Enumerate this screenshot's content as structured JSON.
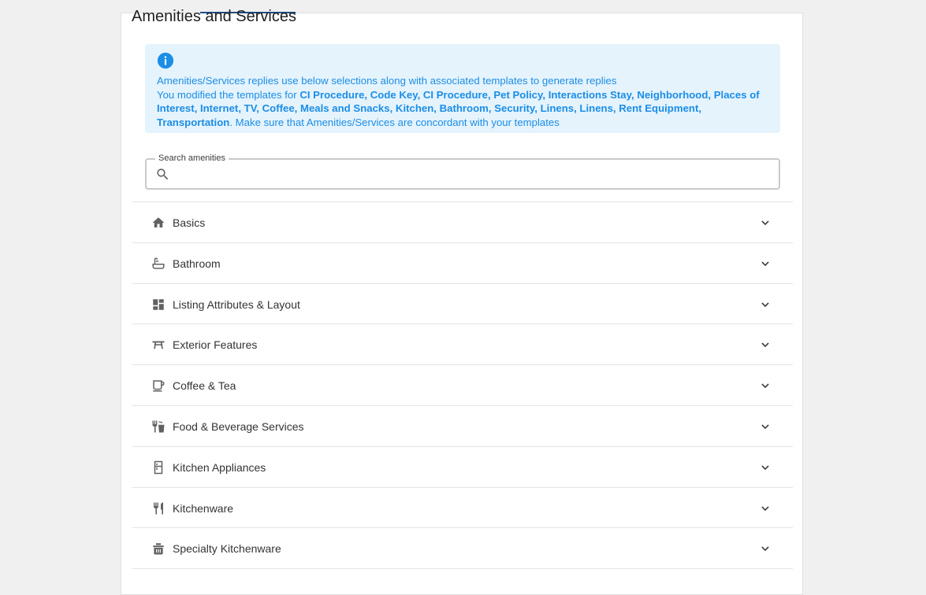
{
  "section": {
    "title": "Amenities and Services"
  },
  "info": {
    "line1": "Amenities/Services replies use below selections along with associated templates to generate replies",
    "modified_prefix": "You modified the templates for ",
    "modified_templates": "CI Procedure, Code Key, CI Procedure, Pet Policy, Interactions Stay, Neighborhood, Places of Interest, Internet, TV, Coffee, Meals and Snacks, Kitchen, Bathroom, Security, Linens, Linens, Rent Equipment, Transportation",
    "modified_suffix": ". Make sure that Amenities/Services are concordant with your templates"
  },
  "search": {
    "label": "Search amenities",
    "value": "",
    "placeholder": ""
  },
  "categories": [
    {
      "label": "Basics",
      "icon": "home-icon"
    },
    {
      "label": "Bathroom",
      "icon": "bathtub-icon"
    },
    {
      "label": "Listing Attributes & Layout",
      "icon": "dashboard-icon"
    },
    {
      "label": "Exterior Features",
      "icon": "picnic-table-icon"
    },
    {
      "label": "Coffee & Tea",
      "icon": "coffee-maker-icon"
    },
    {
      "label": "Food & Beverage Services",
      "icon": "food-beverage-icon"
    },
    {
      "label": "Kitchen Appliances",
      "icon": "fridge-icon"
    },
    {
      "label": "Kitchenware",
      "icon": "fork-knife-icon"
    },
    {
      "label": "Specialty Kitchenware",
      "icon": "cooking-pot-icon"
    }
  ],
  "colors": {
    "accent": "#1b8ee6",
    "info_bg": "#e5f3fd",
    "tab_underline": "#1e4f8a"
  }
}
